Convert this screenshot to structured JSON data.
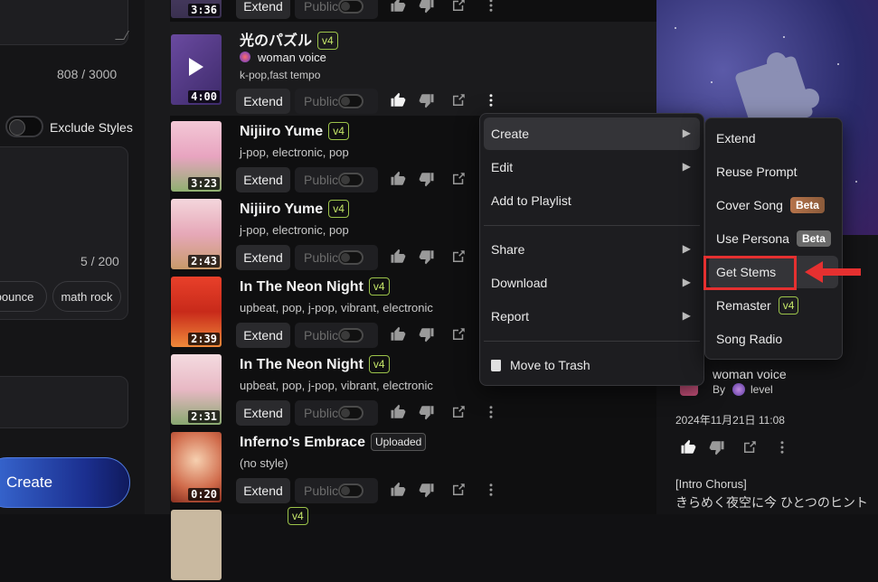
{
  "left": {
    "counter_prompt": "808 / 3000",
    "exclude_styles_label": "Exclude Styles",
    "counter_styles": "5 / 200",
    "chips": [
      "bounce",
      "math rock"
    ],
    "create_label": "Create"
  },
  "songs": [
    {
      "duration": "3:36",
      "extend": "Extend",
      "public": "Public"
    },
    {
      "title": "光のパズル",
      "badge": "v4",
      "voice": "woman voice",
      "tags": "k-pop,fast tempo",
      "duration": "4:00",
      "extend": "Extend",
      "public": "Public"
    },
    {
      "title": "Nijiiro Yume",
      "badge": "v4",
      "tags": "j-pop, electronic, pop",
      "duration": "3:23",
      "extend": "Extend",
      "public": "Public"
    },
    {
      "title": "Nijiiro Yume",
      "badge": "v4",
      "tags": "j-pop, electronic, pop",
      "duration": "2:43",
      "extend": "Extend",
      "public": "Public"
    },
    {
      "title": "In The Neon Night",
      "badge": "v4",
      "tags": "upbeat, pop, j-pop, vibrant, electronic",
      "duration": "2:39",
      "extend": "Extend",
      "public": "Public"
    },
    {
      "title": "In The Neon Night",
      "badge": "v4",
      "tags": "upbeat, pop, j-pop, vibrant, electronic",
      "duration": "2:31",
      "extend": "Extend",
      "public": "Public"
    },
    {
      "title": "Inferno's Embrace",
      "badge": "Uploaded",
      "tags": "(no style)",
      "duration": "0:20",
      "extend": "Extend",
      "public": "Public"
    },
    {
      "badge": "v4"
    }
  ],
  "context_menu": {
    "create": "Create",
    "edit": "Edit",
    "add_to_playlist": "Add to Playlist",
    "share": "Share",
    "download": "Download",
    "report": "Report",
    "move_to_trash": "Move to Trash"
  },
  "submenu": {
    "extend": "Extend",
    "reuse_prompt": "Reuse Prompt",
    "cover_song": "Cover Song",
    "cover_song_badge": "Beta",
    "use_persona": "Use Persona",
    "use_persona_badge": "Beta",
    "get_stems": "Get Stems",
    "remaster": "Remaster",
    "remaster_badge": "v4",
    "song_radio": "Song Radio"
  },
  "right": {
    "voice": "woman voice",
    "by": "By",
    "user": "level",
    "date": "2024年11月21日 11:08",
    "lyrics_1": "[Intro Chorus]",
    "lyrics_2": "きらめく夜空に今 ひとつのヒント"
  },
  "colors": {
    "highlight": "#e53030",
    "v4_badge": "#c7e86a",
    "create_button": "#3a6cd6"
  }
}
